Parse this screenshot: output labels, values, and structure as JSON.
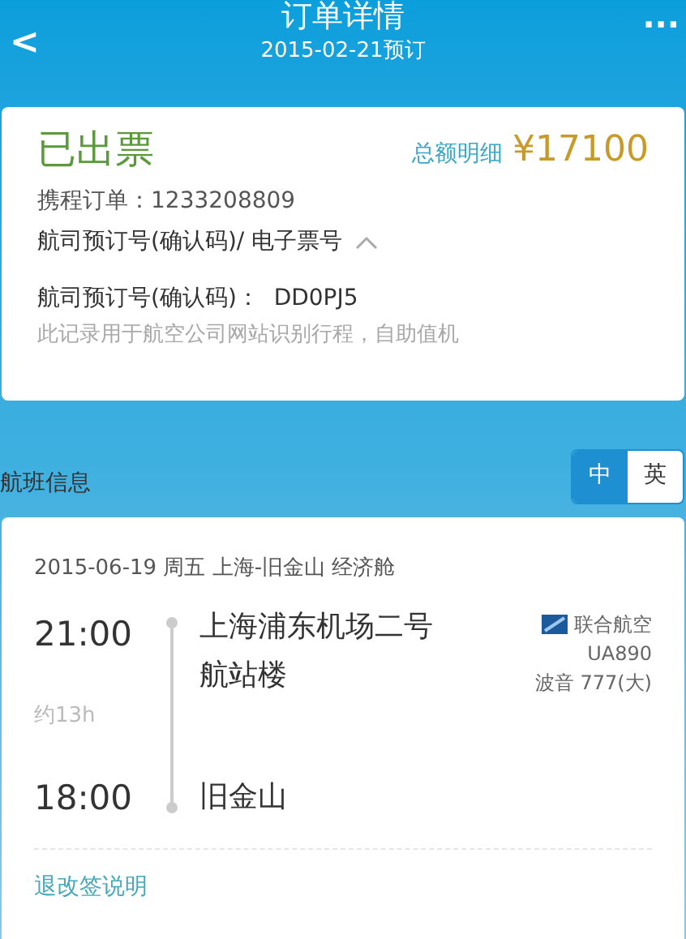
{
  "header": {
    "title": "订单详情",
    "subtitle": "2015-02-21预订",
    "back": "<",
    "more": "···"
  },
  "order": {
    "status": "已出票",
    "total_label": "总额明细",
    "currency": "¥",
    "total": "17100",
    "trip_order": "携程订单：1233208809",
    "pnr_toggle": "航司预订号(确认码)/ 电子票号",
    "expanded": true,
    "pnr": "航司预订号(确认码)：  DD0PJ5",
    "note": "此记录用于航空公司网站识别行程，自助值机"
  },
  "flight_section": {
    "title": "航班信息",
    "languages": [
      {
        "label": "中",
        "selected": true
      },
      {
        "label": "英",
        "selected": false
      }
    ]
  },
  "flight": {
    "summary": "2015-06-19 周五  上海-旧金山  经济舱",
    "depart_time": "21:00",
    "duration": "约13h",
    "arrive_time": "18:00",
    "depart_airport": "上海浦东机场二号航站楼",
    "arrive_airport": "旧金山",
    "airline": "联合航空",
    "flight_no": "UA890",
    "aircraft": "波音 777(大)",
    "policy_link": "退改签说明"
  }
}
